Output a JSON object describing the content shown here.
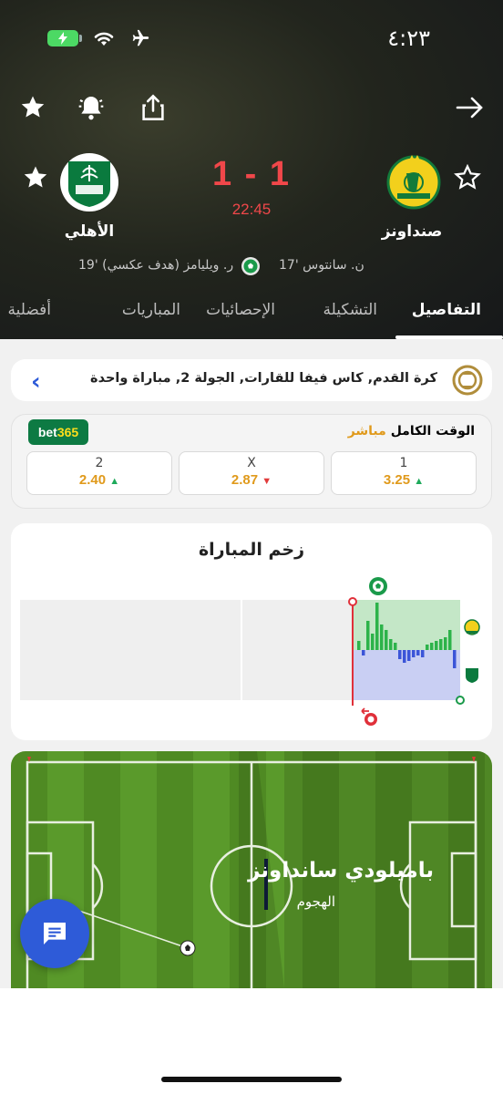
{
  "status_bar": {
    "time": "٤:٢٣"
  },
  "match": {
    "home_team": "صنداونز",
    "away_team": "الأهلي",
    "score": "1 - 1",
    "clock": "22:45",
    "home_scorer": "ن. سانتوس '17",
    "away_scorer": "ر. ويليامز (هدف عكسي) '19"
  },
  "tabs": [
    {
      "label": "التفاصيل",
      "active": true
    },
    {
      "label": "التشكيلة"
    },
    {
      "label": "الإحصائيات"
    },
    {
      "label": "المباريات"
    },
    {
      "label": "أفضلية"
    }
  ],
  "league": {
    "text": "كرة القدم, كاس فيفا للقارات, الجولة 2, مباراة واحدة"
  },
  "odds": {
    "title": "الوقت الكامل",
    "live": "مباشر",
    "bookmaker_prefix": "bet",
    "bookmaker_suffix": "365",
    "items": [
      {
        "label": "1",
        "value": "3.25",
        "trend": "up"
      },
      {
        "label": "X",
        "value": "2.87",
        "trend": "down"
      },
      {
        "label": "2",
        "value": "2.40",
        "trend": "up"
      }
    ]
  },
  "momentum": {
    "title": "زخم المباراة",
    "home_color": "#9fd8a5",
    "away_color": "#b8c3f2"
  },
  "pitch": {
    "attacking_team": "باميلودي سانداونز",
    "attack_type": "الهجوم"
  },
  "colors": {
    "accent": "#2e5bd8",
    "score_red": "#f0474a",
    "odds_orange": "#e09a1c"
  }
}
